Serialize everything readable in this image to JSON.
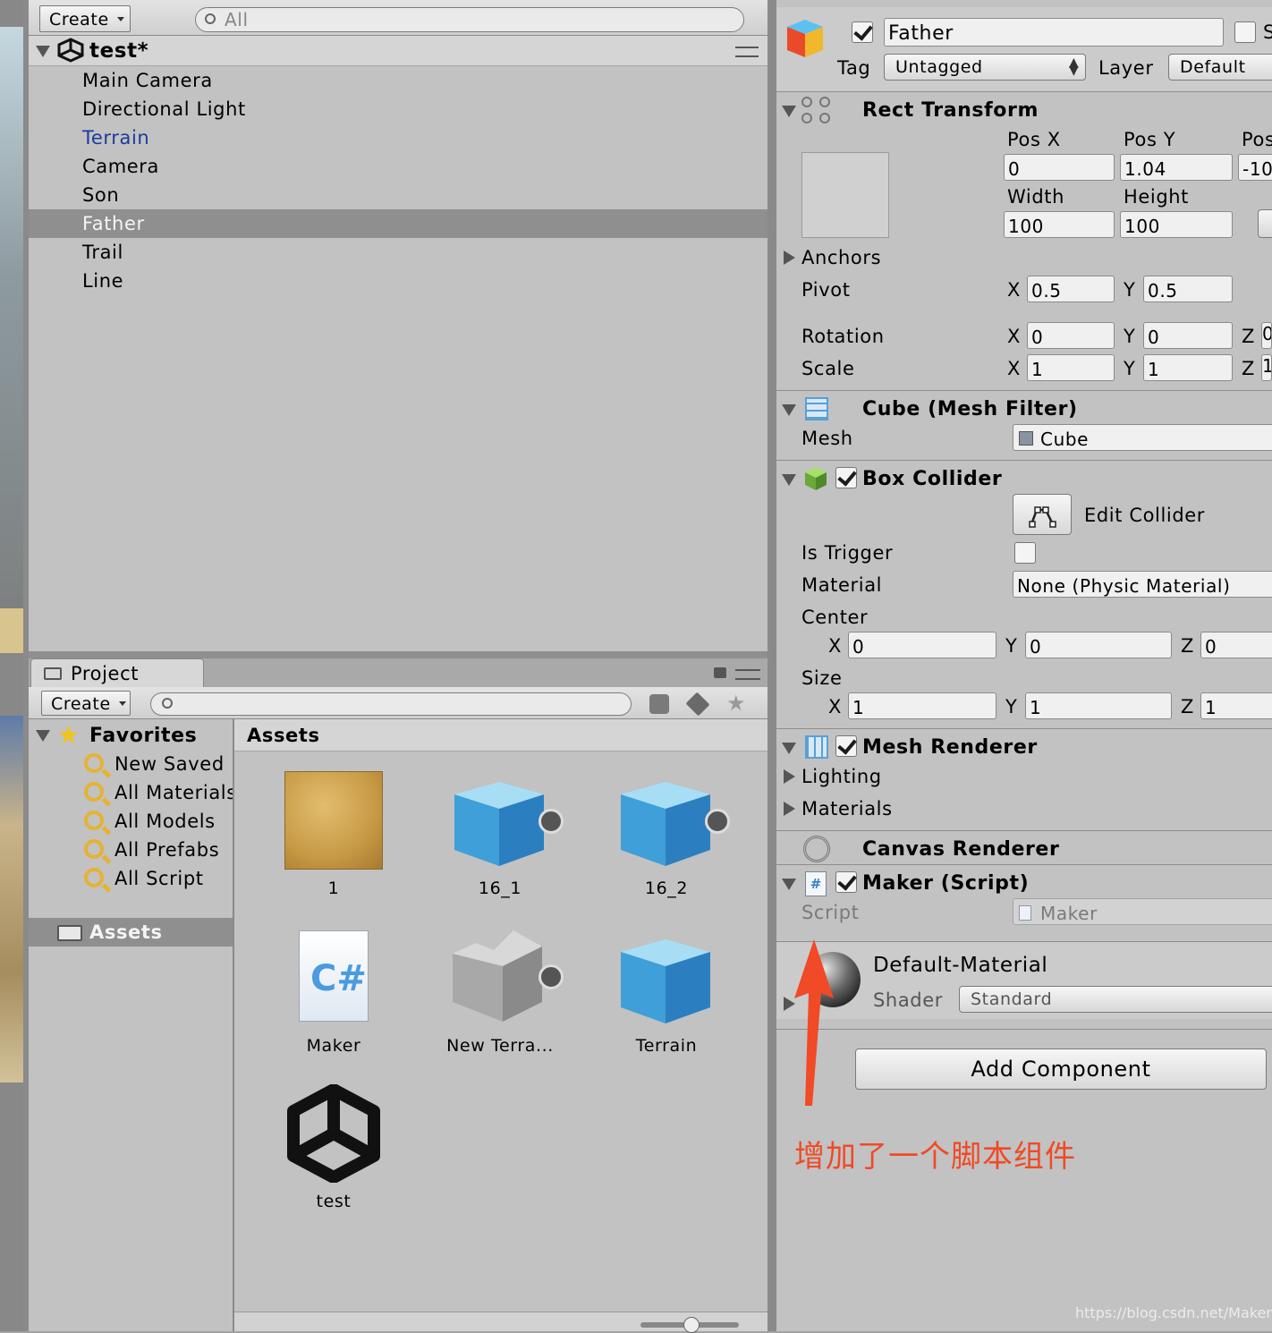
{
  "hierarchy": {
    "create_label": "Create",
    "search_placeholder": "All",
    "scene_name": "test*",
    "items": [
      {
        "label": "Main Camera"
      },
      {
        "label": "Directional Light"
      },
      {
        "label": "Terrain"
      },
      {
        "label": "Camera"
      },
      {
        "label": "Son"
      },
      {
        "label": "Father"
      },
      {
        "label": "Trail"
      },
      {
        "label": "Line"
      }
    ],
    "selected": "Father"
  },
  "project": {
    "tab_label": "Project",
    "create_label": "Create",
    "favorites_label": "Favorites",
    "favorites": [
      "New Saved",
      "All Materials",
      "All Models",
      "All Prefabs",
      "All Script"
    ],
    "assets_folder": "Assets",
    "breadcrumb": "Assets",
    "assets": [
      {
        "name": "1",
        "kind": "texture"
      },
      {
        "name": "16_1",
        "kind": "prefab"
      },
      {
        "name": "16_2",
        "kind": "prefab"
      },
      {
        "name": "Maker",
        "kind": "script"
      },
      {
        "name": "New Terra...",
        "kind": "terrain"
      },
      {
        "name": "Terrain",
        "kind": "prefab"
      },
      {
        "name": "test",
        "kind": "scene"
      }
    ]
  },
  "inspector": {
    "object_name": "Father",
    "static_label": "S",
    "tag_label": "Tag",
    "tag_value": "Untagged",
    "layer_label": "Layer",
    "layer_value": "Default",
    "rect_transform": {
      "title": "Rect Transform",
      "pos_x_label": "Pos X",
      "pos_x": "0",
      "pos_y_label": "Pos Y",
      "pos_y": "1.04",
      "pos_z_label": "Pos",
      "pos_z": "-10",
      "width_label": "Width",
      "width": "100",
      "height_label": "Height",
      "height": "100",
      "anchors_label": "Anchors",
      "pivot_label": "Pivot",
      "pivot_x": "0.5",
      "pivot_y": "0.5",
      "rotation_label": "Rotation",
      "rot_x": "0",
      "rot_y": "0",
      "rot_z": "0",
      "scale_label": "Scale",
      "scale_x": "1",
      "scale_y": "1",
      "scale_z": "1"
    },
    "mesh_filter": {
      "title": "Cube (Mesh Filter)",
      "mesh_label": "Mesh",
      "mesh_value": "Cube"
    },
    "box_collider": {
      "title": "Box Collider",
      "edit_label": "Edit Collider",
      "trigger_label": "Is Trigger",
      "material_label": "Material",
      "material_value": "None (Physic Material)",
      "center_label": "Center",
      "center_x": "0",
      "center_y": "0",
      "center_z": "0",
      "size_label": "Size",
      "size_x": "1",
      "size_y": "1",
      "size_z": "1"
    },
    "mesh_renderer": {
      "title": "Mesh Renderer",
      "lighting_label": "Lighting",
      "materials_label": "Materials"
    },
    "canvas_renderer": {
      "title": "Canvas Renderer"
    },
    "maker_script": {
      "title": "Maker (Script)",
      "script_label": "Script",
      "script_value": "Maker"
    },
    "material": {
      "name": "Default-Material",
      "shader_label": "Shader",
      "shader_value": "Standard"
    },
    "add_component_label": "Add Component"
  },
  "annotation": {
    "text": "增加了一个脚本组件",
    "color": "#f04a26"
  },
  "watermark": "https://blog.csdn.net/MakerLiu",
  "axis_labels": {
    "x": "X",
    "y": "Y",
    "z": "Z"
  }
}
